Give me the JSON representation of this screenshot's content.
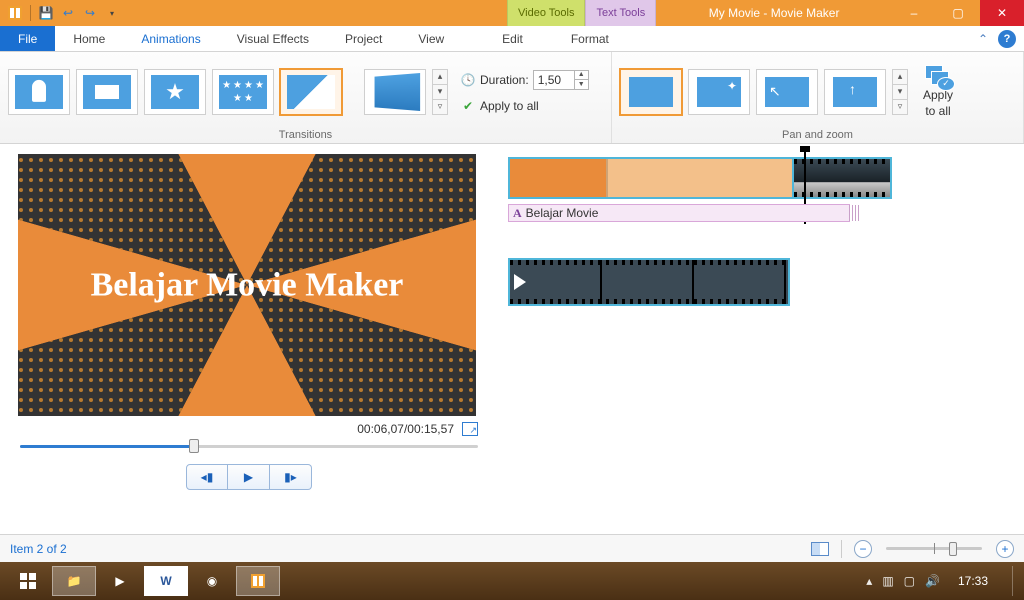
{
  "window": {
    "title": "My Movie - Movie Maker",
    "context_tabs": {
      "video": "Video Tools",
      "text": "Text Tools"
    },
    "controls": {
      "min": "–",
      "max": "▢",
      "close": "✕"
    }
  },
  "qat": {
    "save_tip": "Save",
    "undo_tip": "Undo",
    "redo_tip": "Redo"
  },
  "tabs": {
    "file": "File",
    "home": "Home",
    "animations": "Animations",
    "visual_effects": "Visual Effects",
    "project": "Project",
    "view": "View",
    "edit": "Edit",
    "format": "Format"
  },
  "ribbon": {
    "transitions": {
      "label": "Transitions",
      "duration_label": "Duration:",
      "duration_value": "1,50",
      "apply_all": "Apply to all"
    },
    "panzoom": {
      "label": "Pan and zoom",
      "apply_all_line1": "Apply",
      "apply_all_line2": "to all"
    }
  },
  "preview": {
    "caption": "Belajar Movie Maker",
    "time": "00:06,07/00:15,57"
  },
  "timeline": {
    "caption_track": "Belajar Movie"
  },
  "status": {
    "item": "Item 2 of 2"
  },
  "taskbar": {
    "clock": "17:33"
  }
}
